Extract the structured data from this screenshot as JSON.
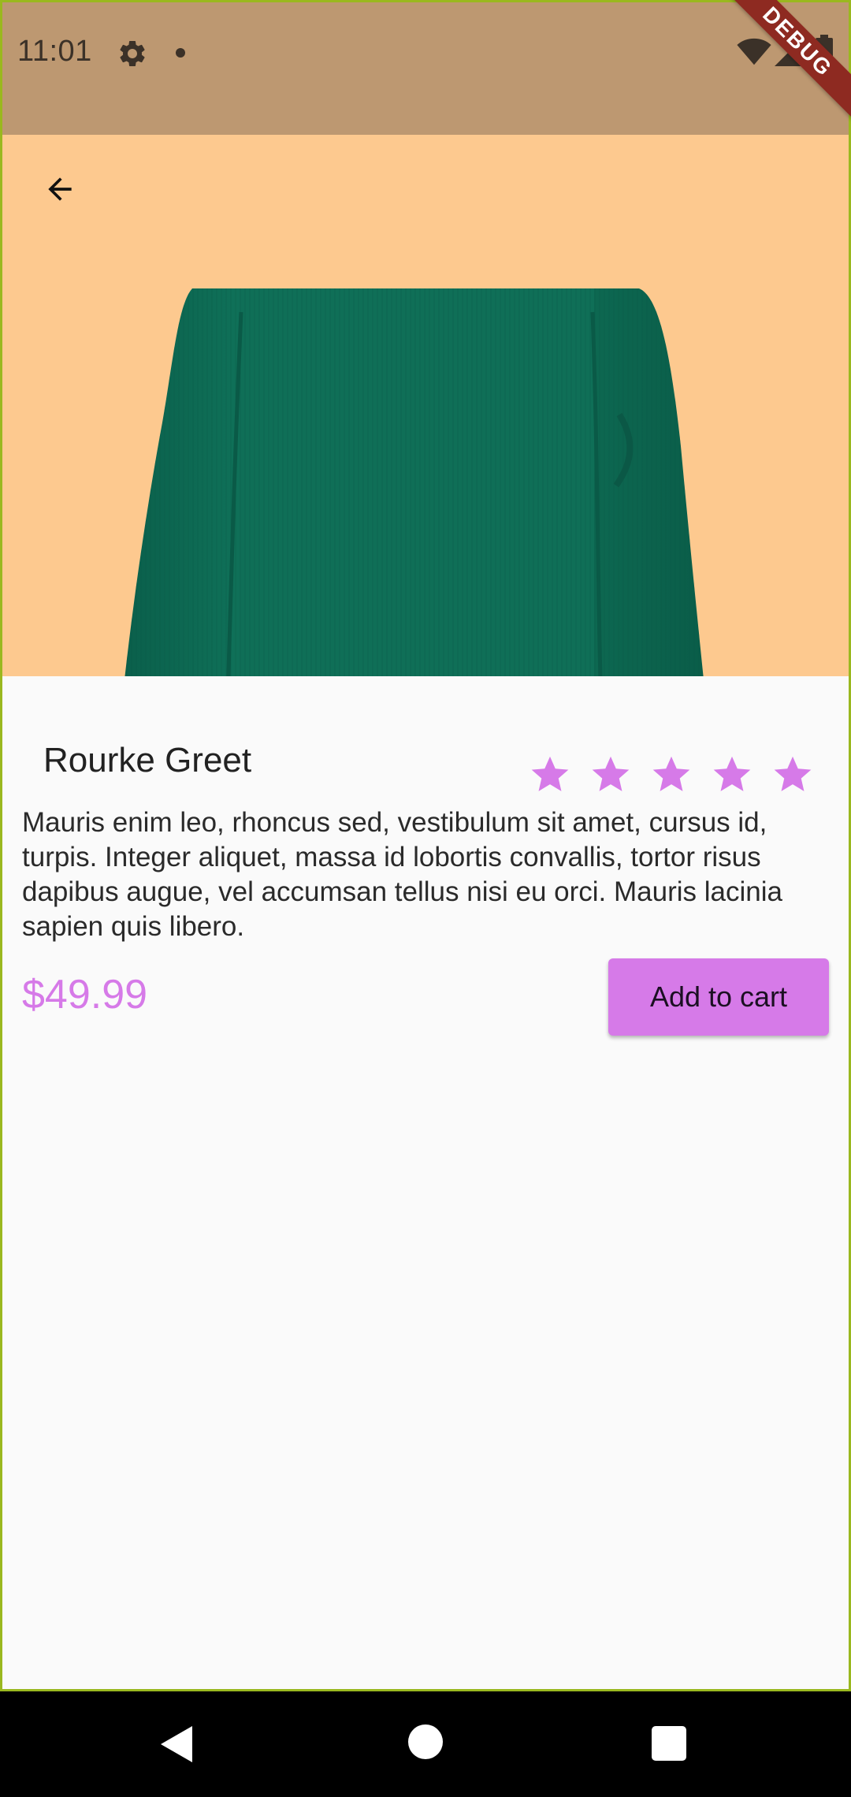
{
  "status_bar": {
    "time": "11:01",
    "icons": [
      "gear-icon",
      "notification-dot-icon",
      "wifi-icon",
      "signal-icon",
      "battery-icon"
    ]
  },
  "debug_banner": {
    "label": "DEBUG",
    "color": "#8e2a21"
  },
  "hero": {
    "background_color": "#fdc98f",
    "image": "green-sweater-image",
    "back_icon": "arrow-back-icon"
  },
  "product": {
    "name": "Rourke Greet",
    "rating": 5,
    "rating_max": 5,
    "description": "Mauris enim leo, rhoncus sed, vestibulum sit amet, cursus id, turpis. Integer aliquet, massa id lobortis convallis, tortor risus dapibus augue, vel accumsan tellus nisi eu orci. Mauris lacinia sapien quis libero.",
    "price": "$49.99",
    "add_to_cart_label": "Add to cart"
  },
  "colors": {
    "accent": "#d67ae8",
    "status_bar": "#bd9871",
    "page_background": "#fafafa"
  },
  "nav_bar": {
    "icons": [
      "nav-back-icon",
      "nav-home-icon",
      "nav-recents-icon"
    ]
  }
}
